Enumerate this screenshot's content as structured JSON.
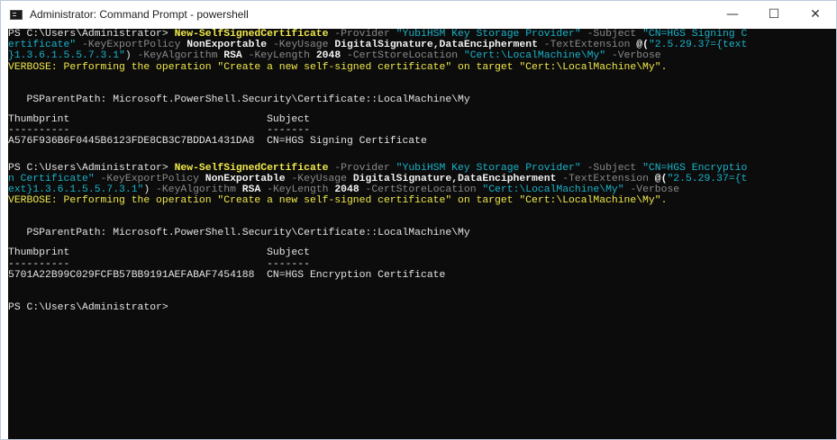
{
  "window": {
    "title": "Administrator: Command Prompt - powershell",
    "minimize": "—",
    "maximize": "☐",
    "close": "✕"
  },
  "console": {
    "cmd1": {
      "prompt": "PS C:\\Users\\Administrator> ",
      "cmdlet": "New-SelfSignedCertificate",
      "p_provider": " -Provider ",
      "v_provider": "\"YubiHSM Key Storage Provider\"",
      "p_subject": " -Subject ",
      "v_subject_a": "\"CN=HGS Signing C",
      "v_subject_b": "ertificate\"",
      "p_keyexport": " -KeyExportPolicy ",
      "v_keyexport": "NonExportable",
      "p_keyusage": " -KeyUsage ",
      "v_keyusage": "DigitalSignature,DataEncipherment",
      "p_textext": " -TextExtension ",
      "v_textext_a": "@(",
      "v_textext_b": "\"2.5.29.37={text",
      "v_textext_c": "}1.3.6.1.5.5.7.3.1\"",
      "v_textext_d": ")",
      "p_keyalg": " -KeyAlgorithm ",
      "v_keyalg": "RSA",
      "p_keylen": " -KeyLength ",
      "v_keylen": "2048",
      "p_store": " -CertStoreLocation ",
      "v_store": "\"Cert:\\LocalMachine\\My\"",
      "p_verbose": " -Verbose",
      "verbose": "VERBOSE: Performing the operation \"Create a new self-signed certificate\" on target \"Cert:\\LocalMachine\\My\".",
      "psparent": "   PSParentPath: Microsoft.PowerShell.Security\\Certificate::LocalMachine\\My",
      "header": "Thumbprint                                Subject",
      "underline": "----------                                -------",
      "row": "A576F936B6F0445B6123FDE8CB3C7BDDA1431DA8  CN=HGS Signing Certificate"
    },
    "cmd2": {
      "prompt": "PS C:\\Users\\Administrator> ",
      "cmdlet": "New-SelfSignedCertificate",
      "p_provider": " -Provider ",
      "v_provider": "\"YubiHSM Key Storage Provider\"",
      "p_subject": " -Subject ",
      "v_subject_a": "\"CN=HGS Encryptio",
      "v_subject_b": "n Certificate\"",
      "p_keyexport": " -KeyExportPolicy ",
      "v_keyexport": "NonExportable",
      "p_keyusage": " -KeyUsage ",
      "v_keyusage": "DigitalSignature,DataEncipherment",
      "p_textext": " -TextExtension ",
      "v_textext_a": "@(",
      "v_textext_b": "\"2.5.29.37={t",
      "v_textext_c": "ext}1.3.6.1.5.5.7.3.1\"",
      "v_textext_d": ")",
      "p_keyalg": " -KeyAlgorithm ",
      "v_keyalg": "RSA",
      "p_keylen": " -KeyLength ",
      "v_keylen": "2048",
      "p_store": " -CertStoreLocation ",
      "v_store": "\"Cert:\\LocalMachine\\My\"",
      "p_verbose": " -Verbose",
      "verbose": "VERBOSE: Performing the operation \"Create a new self-signed certificate\" on target \"Cert:\\LocalMachine\\My\".",
      "psparent": "   PSParentPath: Microsoft.PowerShell.Security\\Certificate::LocalMachine\\My",
      "header": "Thumbprint                                Subject",
      "underline": "----------                                -------",
      "row": "5701A22B99C029FCFB57BB9191AEFABAF7454188  CN=HGS Encryption Certificate"
    },
    "final_prompt": "PS C:\\Users\\Administrator>"
  },
  "colors": {
    "console_bg": "#0c0c0c",
    "text": "#c0c0c0",
    "cmdlet": "#f0e84a",
    "parameter": "#8a8a8a",
    "string": "#1ab2c8",
    "verbose": "#f0e84a"
  },
  "icons": {
    "app": "console-app-icon"
  }
}
